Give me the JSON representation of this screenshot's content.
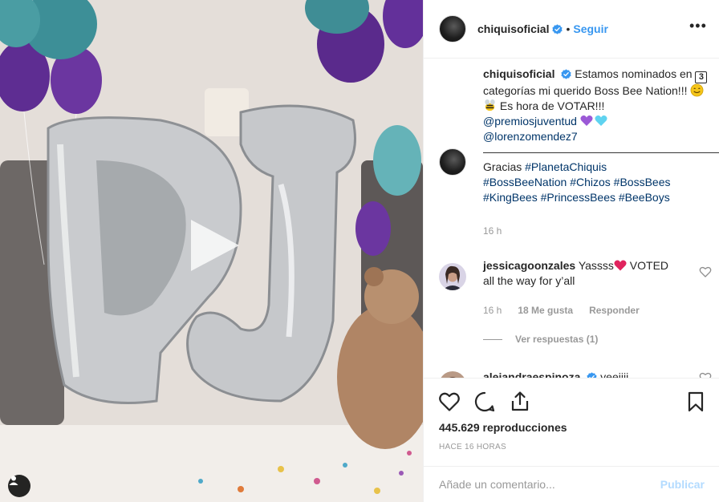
{
  "post": {
    "username": "chiquisoficial",
    "follow_label": "Seguir",
    "dot": "•",
    "more_label": "•••"
  },
  "caption": {
    "username": "chiquisoficial",
    "line1": "Estamos nominados en",
    "num_emoji": "3",
    "line2": "categorías mi querido Boss Bee Nation!!!",
    "line3": "Es hora de VOTAR!!!",
    "mention1": "@premiosjuventud",
    "mention2": "@lorenzomendez7",
    "dashes": "——————————————————————————",
    "thanks": "Gracias",
    "tags": [
      "#PlanetaChiquis",
      "#BossBeeNation",
      "#Chizos",
      "#BossBees",
      "#KingBees",
      "#PrincessBees",
      "#BeeBoys"
    ],
    "time": "16 h"
  },
  "comments": [
    {
      "username": "jessicagoonzales",
      "text_a": "Yassss",
      "text_b": "VOTED all the way for y’all",
      "time": "16 h",
      "likes": "18 Me gusta",
      "reply": "Responder",
      "view_replies": "Ver respuestas (1)"
    },
    {
      "username": "alejandraespinoza",
      "text": "yeeiiii"
    }
  ],
  "actions": {
    "views": "445.629 reproducciones",
    "ago": "HACE 16 HORAS"
  },
  "add_comment": {
    "placeholder": "Añade un comentario...",
    "publish": "Publicar"
  },
  "colors": {
    "link": "#003569",
    "accent": "#3897f0",
    "publish_disabled": "#b3dbff",
    "muted": "#999999"
  }
}
